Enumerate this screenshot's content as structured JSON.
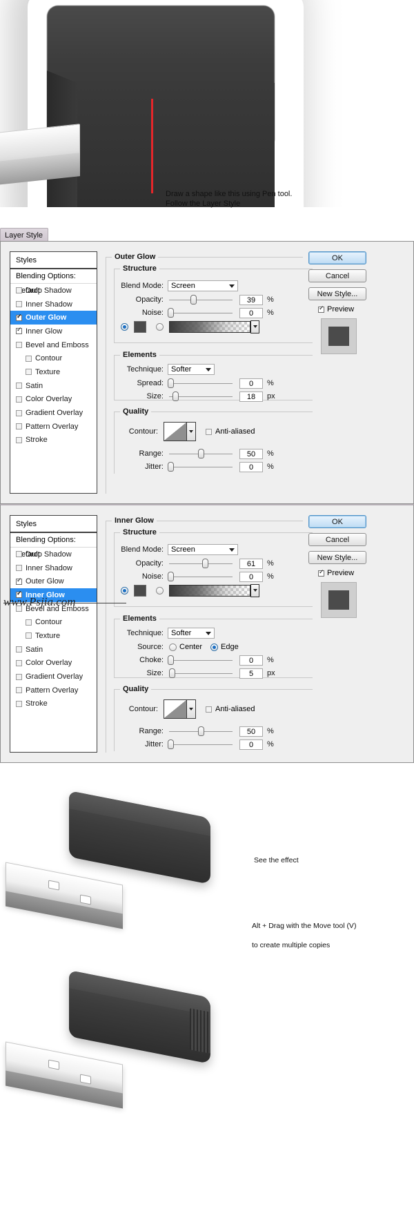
{
  "window": {
    "tab_label": "Layer Style",
    "styles_header": "Styles",
    "blending_options": "Blending Options: Default",
    "watermark": "www.Psjia.com"
  },
  "buttons": {
    "ok": "OK",
    "cancel": "Cancel",
    "new_style": "New Style...",
    "preview": "Preview"
  },
  "style_list": [
    {
      "label": "Drop Shadow",
      "checked": false,
      "indent": false,
      "selected": false
    },
    {
      "label": "Inner Shadow",
      "checked": false,
      "indent": false,
      "selected": false
    },
    {
      "label": "Outer Glow",
      "checked": true,
      "indent": false,
      "selected": true
    },
    {
      "label": "Inner Glow",
      "checked": true,
      "indent": false,
      "selected": false
    },
    {
      "label": "Bevel and Emboss",
      "checked": false,
      "indent": false,
      "selected": false
    },
    {
      "label": "Contour",
      "checked": false,
      "indent": true,
      "selected": false
    },
    {
      "label": "Texture",
      "checked": false,
      "indent": true,
      "selected": false
    },
    {
      "label": "Satin",
      "checked": false,
      "indent": false,
      "selected": false
    },
    {
      "label": "Color Overlay",
      "checked": false,
      "indent": false,
      "selected": false
    },
    {
      "label": "Gradient Overlay",
      "checked": false,
      "indent": false,
      "selected": false
    },
    {
      "label": "Pattern Overlay",
      "checked": false,
      "indent": false,
      "selected": false
    },
    {
      "label": "Stroke",
      "checked": false,
      "indent": false,
      "selected": false
    }
  ],
  "style_list_2": [
    {
      "label": "Drop Shadow",
      "checked": false,
      "indent": false,
      "selected": false
    },
    {
      "label": "Inner Shadow",
      "checked": false,
      "indent": false,
      "selected": false
    },
    {
      "label": "Outer Glow",
      "checked": true,
      "indent": false,
      "selected": false
    },
    {
      "label": "Inner Glow",
      "checked": true,
      "indent": false,
      "selected": true
    },
    {
      "label": "Bevel and Emboss",
      "checked": false,
      "indent": false,
      "selected": false
    },
    {
      "label": "Contour",
      "checked": false,
      "indent": true,
      "selected": false
    },
    {
      "label": "Texture",
      "checked": false,
      "indent": true,
      "selected": false
    },
    {
      "label": "Satin",
      "checked": false,
      "indent": false,
      "selected": false
    },
    {
      "label": "Color Overlay",
      "checked": false,
      "indent": false,
      "selected": false
    },
    {
      "label": "Gradient Overlay",
      "checked": false,
      "indent": false,
      "selected": false
    },
    {
      "label": "Pattern Overlay",
      "checked": false,
      "indent": false,
      "selected": false
    },
    {
      "label": "Stroke",
      "checked": false,
      "indent": false,
      "selected": false
    }
  ],
  "outer_glow": {
    "title": "Outer Glow",
    "structure_title": "Structure",
    "elements_title": "Elements",
    "quality_title": "Quality",
    "blend_mode_label": "Blend Mode:",
    "blend_mode_value": "Screen",
    "opacity_label": "Opacity:",
    "opacity_value": "39",
    "opacity_unit": "%",
    "noise_label": "Noise:",
    "noise_value": "0",
    "noise_unit": "%",
    "color_hex": "#4a4a4a",
    "technique_label": "Technique:",
    "technique_value": "Softer",
    "spread_label": "Spread:",
    "spread_value": "0",
    "spread_unit": "%",
    "size_label": "Size:",
    "size_value": "18",
    "size_unit": "px",
    "contour_label": "Contour:",
    "anti_aliased_label": "Anti-aliased",
    "range_label": "Range:",
    "range_value": "50",
    "range_unit": "%",
    "jitter_label": "Jitter:",
    "jitter_value": "0",
    "jitter_unit": "%"
  },
  "inner_glow": {
    "title": "Inner Glow",
    "structure_title": "Structure",
    "elements_title": "Elements",
    "quality_title": "Quality",
    "blend_mode_label": "Blend Mode:",
    "blend_mode_value": "Screen",
    "opacity_label": "Opacity:",
    "opacity_value": "61",
    "opacity_unit": "%",
    "noise_label": "Noise:",
    "noise_value": "0",
    "noise_unit": "%",
    "color_hex": "#4a4a4a",
    "technique_label": "Technique:",
    "technique_value": "Softer",
    "source_label": "Source:",
    "source_center": "Center",
    "source_edge": "Edge",
    "choke_label": "Choke:",
    "choke_value": "0",
    "choke_unit": "%",
    "size_label": "Size:",
    "size_value": "5",
    "size_unit": "px",
    "contour_label": "Contour:",
    "anti_aliased_label": "Anti-aliased",
    "range_label": "Range:",
    "range_value": "50",
    "range_unit": "%",
    "jitter_label": "Jitter:",
    "jitter_value": "0",
    "jitter_unit": "%"
  },
  "captions": {
    "top_line1": "Draw a shape like this using Pen tool.",
    "top_line2": "Follow the Layer Style",
    "see_effect": "See the effect",
    "bottom_line1": "Alt + Drag with the Move tool (V)",
    "bottom_line2": "to create multiple copies"
  }
}
